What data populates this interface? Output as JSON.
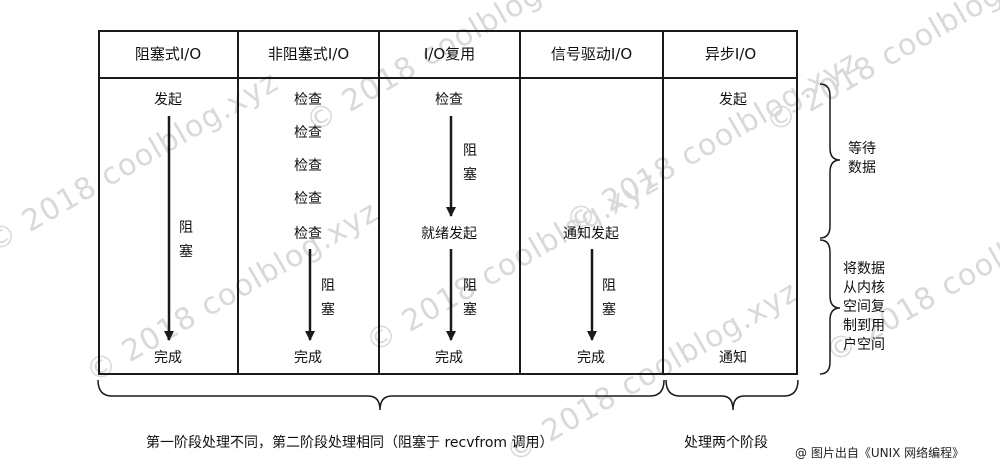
{
  "watermark": "© 2018 coolblog.xyz",
  "columns": [
    {
      "header": "阻塞式I/O",
      "steps": [
        "发起",
        "完成"
      ],
      "block_label": "阻\n塞"
    },
    {
      "header": "非阻塞式I/O",
      "steps": [
        "检查",
        "检查",
        "检查",
        "检查",
        "检查",
        "完成"
      ],
      "block_label": "阻\n塞"
    },
    {
      "header": "I/O复用",
      "steps": [
        "检查",
        "就绪发起",
        "完成"
      ],
      "block_label": "阻\n塞",
      "block_label_2": "阻\n塞"
    },
    {
      "header": "信号驱动I/O",
      "steps": [
        "通知发起",
        "完成"
      ],
      "block_label": "阻\n塞"
    },
    {
      "header": "异步I/O",
      "steps": [
        "发起",
        "通知"
      ]
    }
  ],
  "side_labels": {
    "wait": "等待\n数据",
    "copy": "将数据\n从内核\n空间复\n制到用\n户空间"
  },
  "bottom": {
    "left": "第一阶段处理不同，第二阶段处理相同（阻塞于 recvfrom 调用）",
    "right": "处理两个阶段"
  },
  "credit": "@ 图片出自《UNIX 网络编程》",
  "colors": {
    "line": "#1a1a1a",
    "watermark": "#d9d9d9"
  }
}
